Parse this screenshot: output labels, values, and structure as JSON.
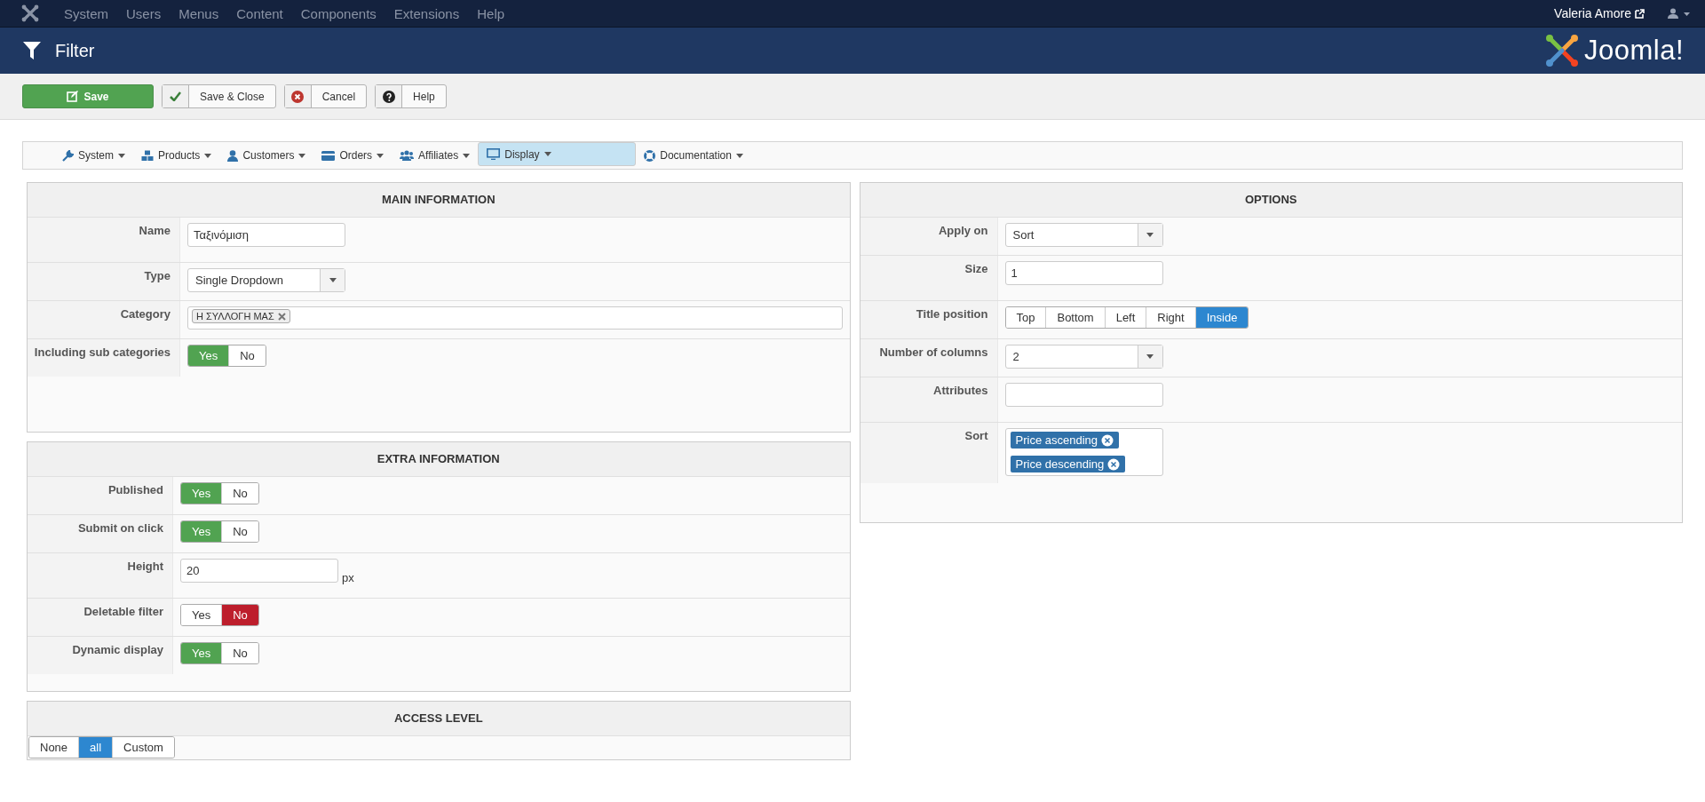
{
  "topbar": {
    "menu": [
      "System",
      "Users",
      "Menus",
      "Content",
      "Components",
      "Extensions",
      "Help"
    ],
    "user": "Valeria Amore"
  },
  "header": {
    "title": "Filter",
    "logo_text": "Joomla!"
  },
  "toolbar": [
    {
      "label": "Save",
      "kind": "primary"
    },
    {
      "label": "Save & Close",
      "kind": "check"
    },
    {
      "label": "Cancel",
      "kind": "cancel"
    },
    {
      "label": "Help",
      "kind": "help"
    }
  ],
  "nav": [
    {
      "label": "System",
      "selected": false
    },
    {
      "label": "Products",
      "selected": false
    },
    {
      "label": "Customers",
      "selected": false
    },
    {
      "label": "Orders",
      "selected": false
    },
    {
      "label": "Affiliates",
      "selected": false
    },
    {
      "label": "Display",
      "selected": true
    },
    {
      "label": "Documentation",
      "selected": false
    }
  ],
  "main_information": {
    "title": "MAIN INFORMATION",
    "fields": [
      {
        "label": "Name",
        "kind": "text",
        "value": "Ταξινόμιση"
      },
      {
        "label": "Type",
        "kind": "select",
        "value": "Single Dropdown"
      },
      {
        "label": "Category",
        "kind": "tags",
        "tags": [
          "Η ΣΥΛΛΟΓΗ ΜΑΣ"
        ]
      },
      {
        "label": "Including sub categories",
        "kind": "yesno",
        "options": [
          {
            "label": "Yes",
            "selected": true
          },
          {
            "label": "No",
            "selected": false
          }
        ]
      }
    ]
  },
  "options": {
    "title": "OPTIONS",
    "fields": [
      {
        "label": "Apply on",
        "kind": "select",
        "value": "Sort"
      },
      {
        "label": "Size",
        "kind": "text",
        "value": "1"
      },
      {
        "label": "Title position",
        "kind": "segmented",
        "options": [
          {
            "label": "Top",
            "selected": false
          },
          {
            "label": "Bottom",
            "selected": false
          },
          {
            "label": "Left",
            "selected": false
          },
          {
            "label": "Right",
            "selected": false
          },
          {
            "label": "Inside",
            "selected": true
          }
        ]
      },
      {
        "label": "Number of columns",
        "kind": "select",
        "value": "2"
      },
      {
        "label": "Attributes",
        "kind": "text"
      },
      {
        "label": "Sort",
        "kind": "multitags",
        "tags": [
          "Price ascending",
          "Price descending"
        ]
      }
    ]
  },
  "extra_information": {
    "title": "EXTRA INFORMATION",
    "fields": [
      {
        "label": "Published",
        "kind": "yesno",
        "options": [
          {
            "label": "Yes",
            "selected": true
          },
          {
            "label": "No",
            "selected": false
          }
        ]
      },
      {
        "label": "Submit on click",
        "kind": "yesno",
        "options": [
          {
            "label": "Yes",
            "selected": true
          },
          {
            "label": "No",
            "selected": false
          }
        ]
      },
      {
        "label": "Height",
        "kind": "text",
        "value": "20",
        "unit": "px"
      },
      {
        "label": "Deletable filter",
        "kind": "yesno",
        "options": [
          {
            "label": "Yes",
            "selected": false
          },
          {
            "label": "No",
            "selected": true
          }
        ]
      },
      {
        "label": "Dynamic display",
        "kind": "yesno",
        "options": [
          {
            "label": "Yes",
            "selected": true
          },
          {
            "label": "No",
            "selected": false
          }
        ]
      }
    ]
  },
  "access_level": {
    "title": "ACCESS LEVEL",
    "kind": "segmented",
    "options": [
      {
        "label": "None",
        "selected": false
      },
      {
        "label": "all",
        "selected": true
      },
      {
        "label": "Custom",
        "selected": false
      }
    ]
  }
}
